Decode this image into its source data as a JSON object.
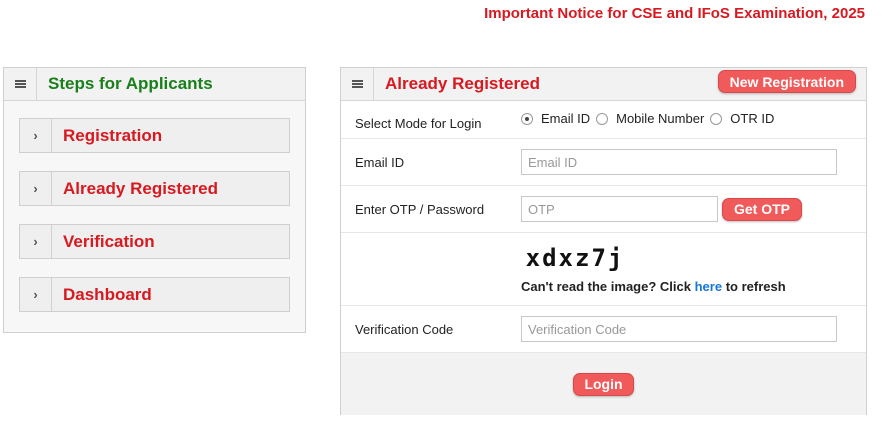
{
  "notice": {
    "text": "Important Notice for CSE and IFoS Examination, 2025"
  },
  "left_panel": {
    "title": "Steps for Applicants",
    "steps": [
      {
        "label": "Registration"
      },
      {
        "label": "Already Registered"
      },
      {
        "label": "Verification"
      },
      {
        "label": "Dashboard"
      }
    ]
  },
  "right_panel": {
    "title": "Already Registered",
    "new_registration_label": "New Registration",
    "login_mode": {
      "label": "Select Mode for Login",
      "options": [
        "Email ID",
        "Mobile Number",
        "OTR ID"
      ],
      "selected": "Email ID"
    },
    "email": {
      "label": "Email ID",
      "placeholder": "Email ID",
      "value": ""
    },
    "otp": {
      "label": "Enter OTP / Password",
      "placeholder": "OTP",
      "value": "",
      "button_label": "Get OTP"
    },
    "captcha": {
      "text": "xdxz7j",
      "note_prefix": "Can't read the image? Click",
      "link_text": "here",
      "note_suffix": "to refresh"
    },
    "verification": {
      "label": "Verification Code",
      "placeholder": "Verification Code",
      "value": ""
    },
    "login_label": "Login"
  },
  "colors": {
    "accent_red": "#d71920",
    "button_red": "#f05a5a",
    "green_title": "#1a7f1a",
    "link_blue": "#1976d2"
  }
}
